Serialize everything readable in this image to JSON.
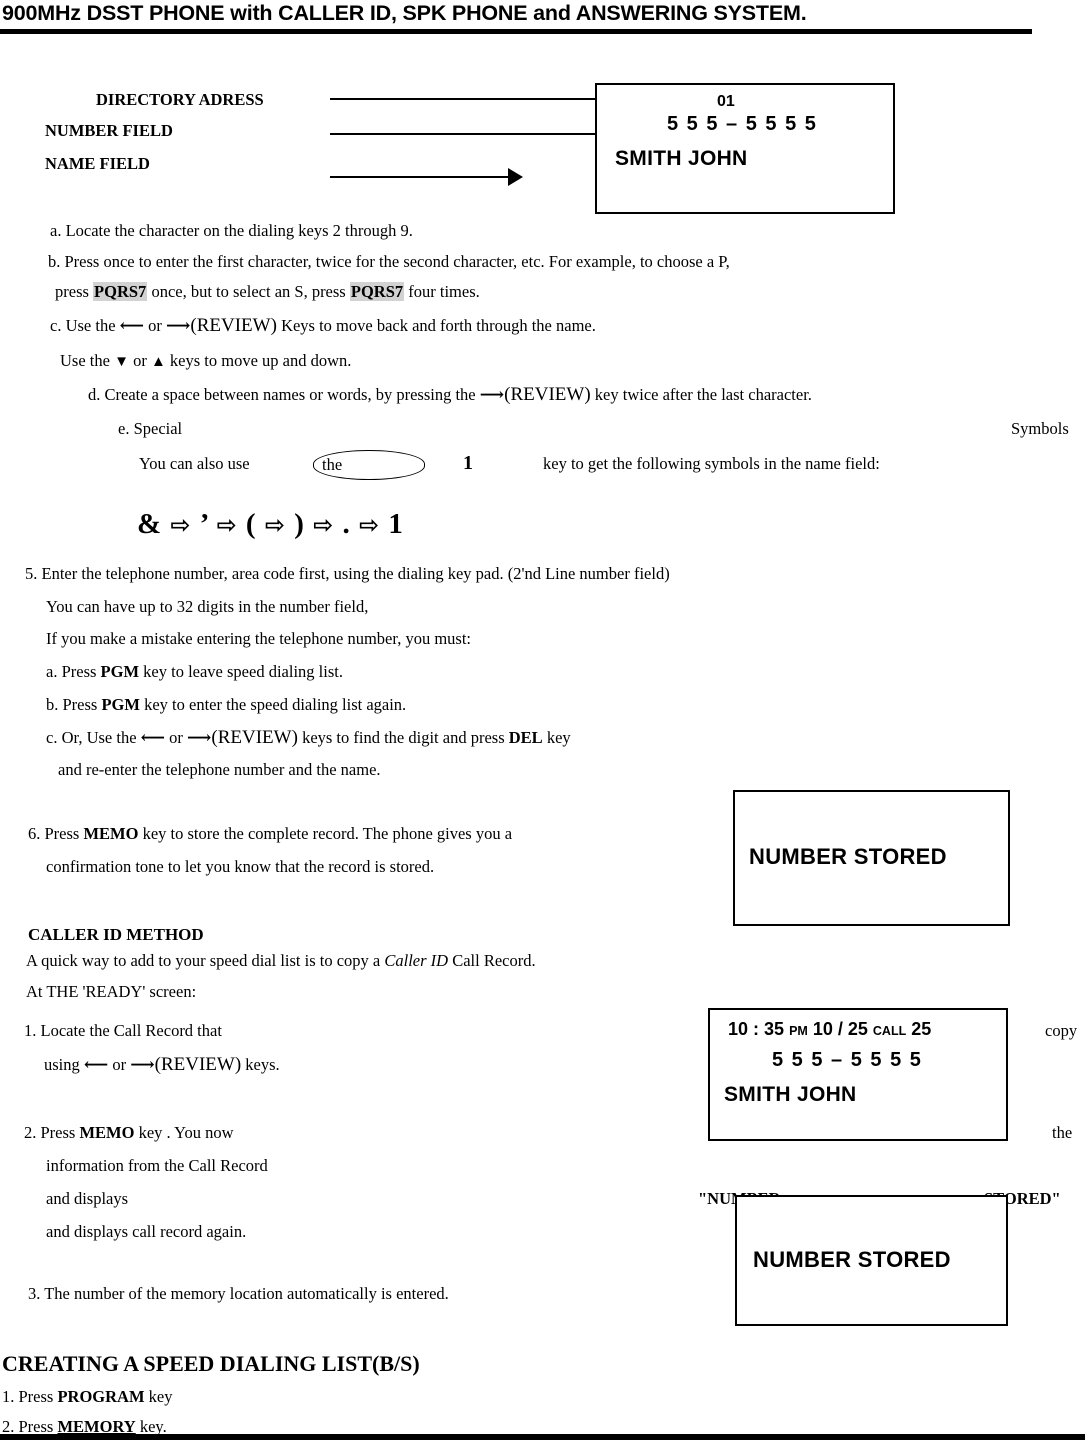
{
  "header": {
    "title": "900MHz DSST PHONE with CALLER ID, SPK PHONE and ANSWERING SYSTEM."
  },
  "diagram": {
    "labels": {
      "directory_address": "DIRECTORY ADRESS",
      "number_field": "NUMBER FIELD",
      "name_field": "NAME FIELD"
    },
    "lcd_main": {
      "address": "01",
      "number": "5 5 5 – 5 5 5 5",
      "name": "SMITH JOHN"
    }
  },
  "steps_name_entry": {
    "a": "a.  Locate the character on the dialing keys 2 through 9.",
    "b_part1": "b.    Press   once   to   enter   the   first   character,   twice   for   the   second   character,   etc.  For   example,   to   choose   a   P,",
    "b_part2_pre": "press ",
    "b_key1": "PQRS7",
    "b_part2_mid": " once, but to select an S, press ",
    "b_key2": "PQRS7",
    "b_part2_post": " four times.",
    "c_pre": "c.  Use the  ",
    "c_arrow_left": "⟵",
    "c_or": "  or  ",
    "c_arrow_right": "⟶",
    "c_review": "(REVIEW)",
    "c_post": " Keys to move back and forth through the name.",
    "c_line2_pre": "Use the ",
    "c_down": "▼",
    "c_line2_or": "  or  ",
    "c_up": "▲",
    "c_line2_post": "  keys to move up and down.",
    "d_pre": "d.    Create a space between names or words, by pressing the ",
    "d_arrow": "⟶",
    "d_review": "(REVIEW)",
    "d_post": " key twice after the last character.",
    "e_label": "e.    Special",
    "e_right": "Symbols",
    "e_line2_pre": "You   can   also   use",
    "e_the": "the",
    "e_one": "1",
    "e_line2_post": "key   to   get   the   following   symbols   in   the   name   field:",
    "symbols": [
      "&",
      "⇨",
      "’",
      "⇨",
      "(",
      "⇨",
      ")",
      "⇨",
      ".",
      "⇨",
      "1"
    ]
  },
  "step5": {
    "line1": "5.  Enter the telephone number, area code first, using the dialing key pad. (2'nd Line number field)",
    "line2": "You can have up to 32 digits in the number field,",
    "line3": "If you make a mistake entering the telephone number, you must:",
    "a_pre": "a.  Press ",
    "a_key": "PGM",
    "a_post": " key to leave speed dialing list.",
    "b_pre": "b.  Press ",
    "b_key": "PGM",
    "b_post": " key to enter the speed dialing list again.",
    "c_pre": "c.  Or, Use the  ",
    "c_arrow_left": "⟵",
    "c_or": " or  ",
    "c_arrow_right": "⟶",
    "c_review": "(REVIEW)",
    "c_mid": " keys to find the digit and press ",
    "c_key": "DEL",
    "c_post": " key",
    "c_line2": "and re-enter the telephone number and the name."
  },
  "step6": {
    "line1_pre": "6.  Press ",
    "line1_key": "MEMO",
    "line1_post": " key to store the complete record.  The phone gives you a",
    "line2": "confirmation tone to let you know that the record is stored.",
    "lcd_stored": "NUMBER STORED"
  },
  "caller_id": {
    "heading": "CALLER ID METHOD",
    "line1_pre": "A quick way to add to your speed dial list is to copy a ",
    "line1_em": "Caller ID",
    "line1_post": " Call Record.",
    "line2": "At THE 'READY' screen:",
    "item1_line1": "1.                        Locate             the             Call             Record             that",
    "item1_trail": "copy",
    "item1_line2_pre": "using ",
    "item1_arrow_left": "⟵",
    "item1_or": "  or  ",
    "item1_arrow_right": "⟶",
    "item1_review": "(REVIEW)",
    "item1_line2_post": "  keys.",
    "item2_line1_pre": "2.                        Press          ",
    "item2_key": "MEMO",
    "item2_line1_post": "          key          .          You          now",
    "item2_trail": "the",
    "item2_line2": "information from the Call Record",
    "item2_line3_pre": "and                                           displays",
    "item2_line3_quoted": "\"NUMBER",
    "item2_line3_quoted2": "STORED\"",
    "item2_line4": "and displays call record again.",
    "item3": "3. The number of the memory location automatically is entered.",
    "lcd_callid": {
      "time": "10 : 35",
      "ampm": "PM",
      "date": "10 / 25",
      "call_label": "CALL",
      "call_number": "25",
      "number": "5 5 5 – 5 5 5 5",
      "name": "SMITH  JOHN"
    },
    "lcd_stored": "NUMBER STORED"
  },
  "speed_dial_section": {
    "heading": "CREATING A SPEED DIALING LIST(B/S)",
    "item1_pre": "1. Press ",
    "item1_key": "PROGRAM",
    "item1_post": " key",
    "item2_pre": "2. Press ",
    "item2_key": "MEMORY",
    "item2_post": " key."
  }
}
